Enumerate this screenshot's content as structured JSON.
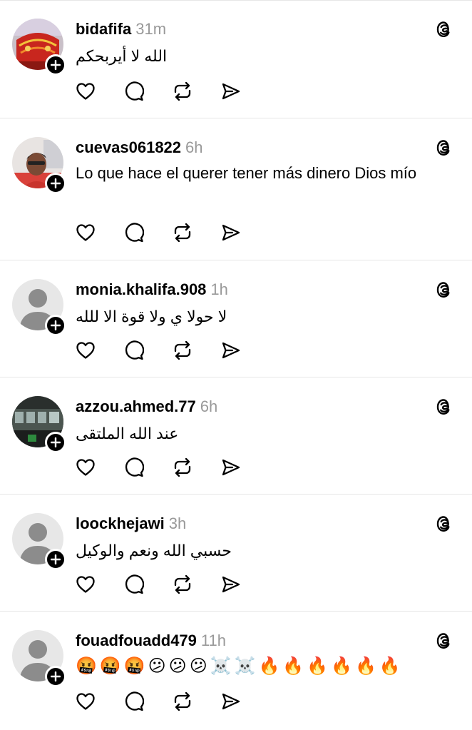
{
  "posts": [
    {
      "username": "bidafifa",
      "time": "31m",
      "text": "الله لا أيربحكم",
      "rtl": true,
      "avatar": "photo-red"
    },
    {
      "username": "cuevas061822",
      "time": "6h",
      "text": "Lo que hace el querer tener más dinero Dios mío",
      "rtl": false,
      "avatar": "photo-person"
    },
    {
      "username": "monia.khalifa.908",
      "time": "1h",
      "text": "لا حولا ي ولا قوة الا للله",
      "rtl": true,
      "avatar": "default"
    },
    {
      "username": "azzou.ahmed.77",
      "time": "6h",
      "text": "عند الله الملتقى",
      "rtl": true,
      "avatar": "photo-train"
    },
    {
      "username": "loockhejawi",
      "time": "3h",
      "text": "حسبي الله ونعم والوكيل",
      "rtl": true,
      "avatar": "default"
    },
    {
      "username": "fouadfouadd479",
      "time": "11h",
      "text": "🤬🤬🤬😕😕😕☠️☠️🔥🔥🔥🔥🔥🔥",
      "rtl": false,
      "avatar": "default"
    }
  ],
  "icons": {
    "like": "heart-icon",
    "reply": "speech-bubble-icon",
    "repost": "repost-icon",
    "share": "send-icon",
    "app": "threads-logo-icon",
    "follow": "plus-icon"
  }
}
